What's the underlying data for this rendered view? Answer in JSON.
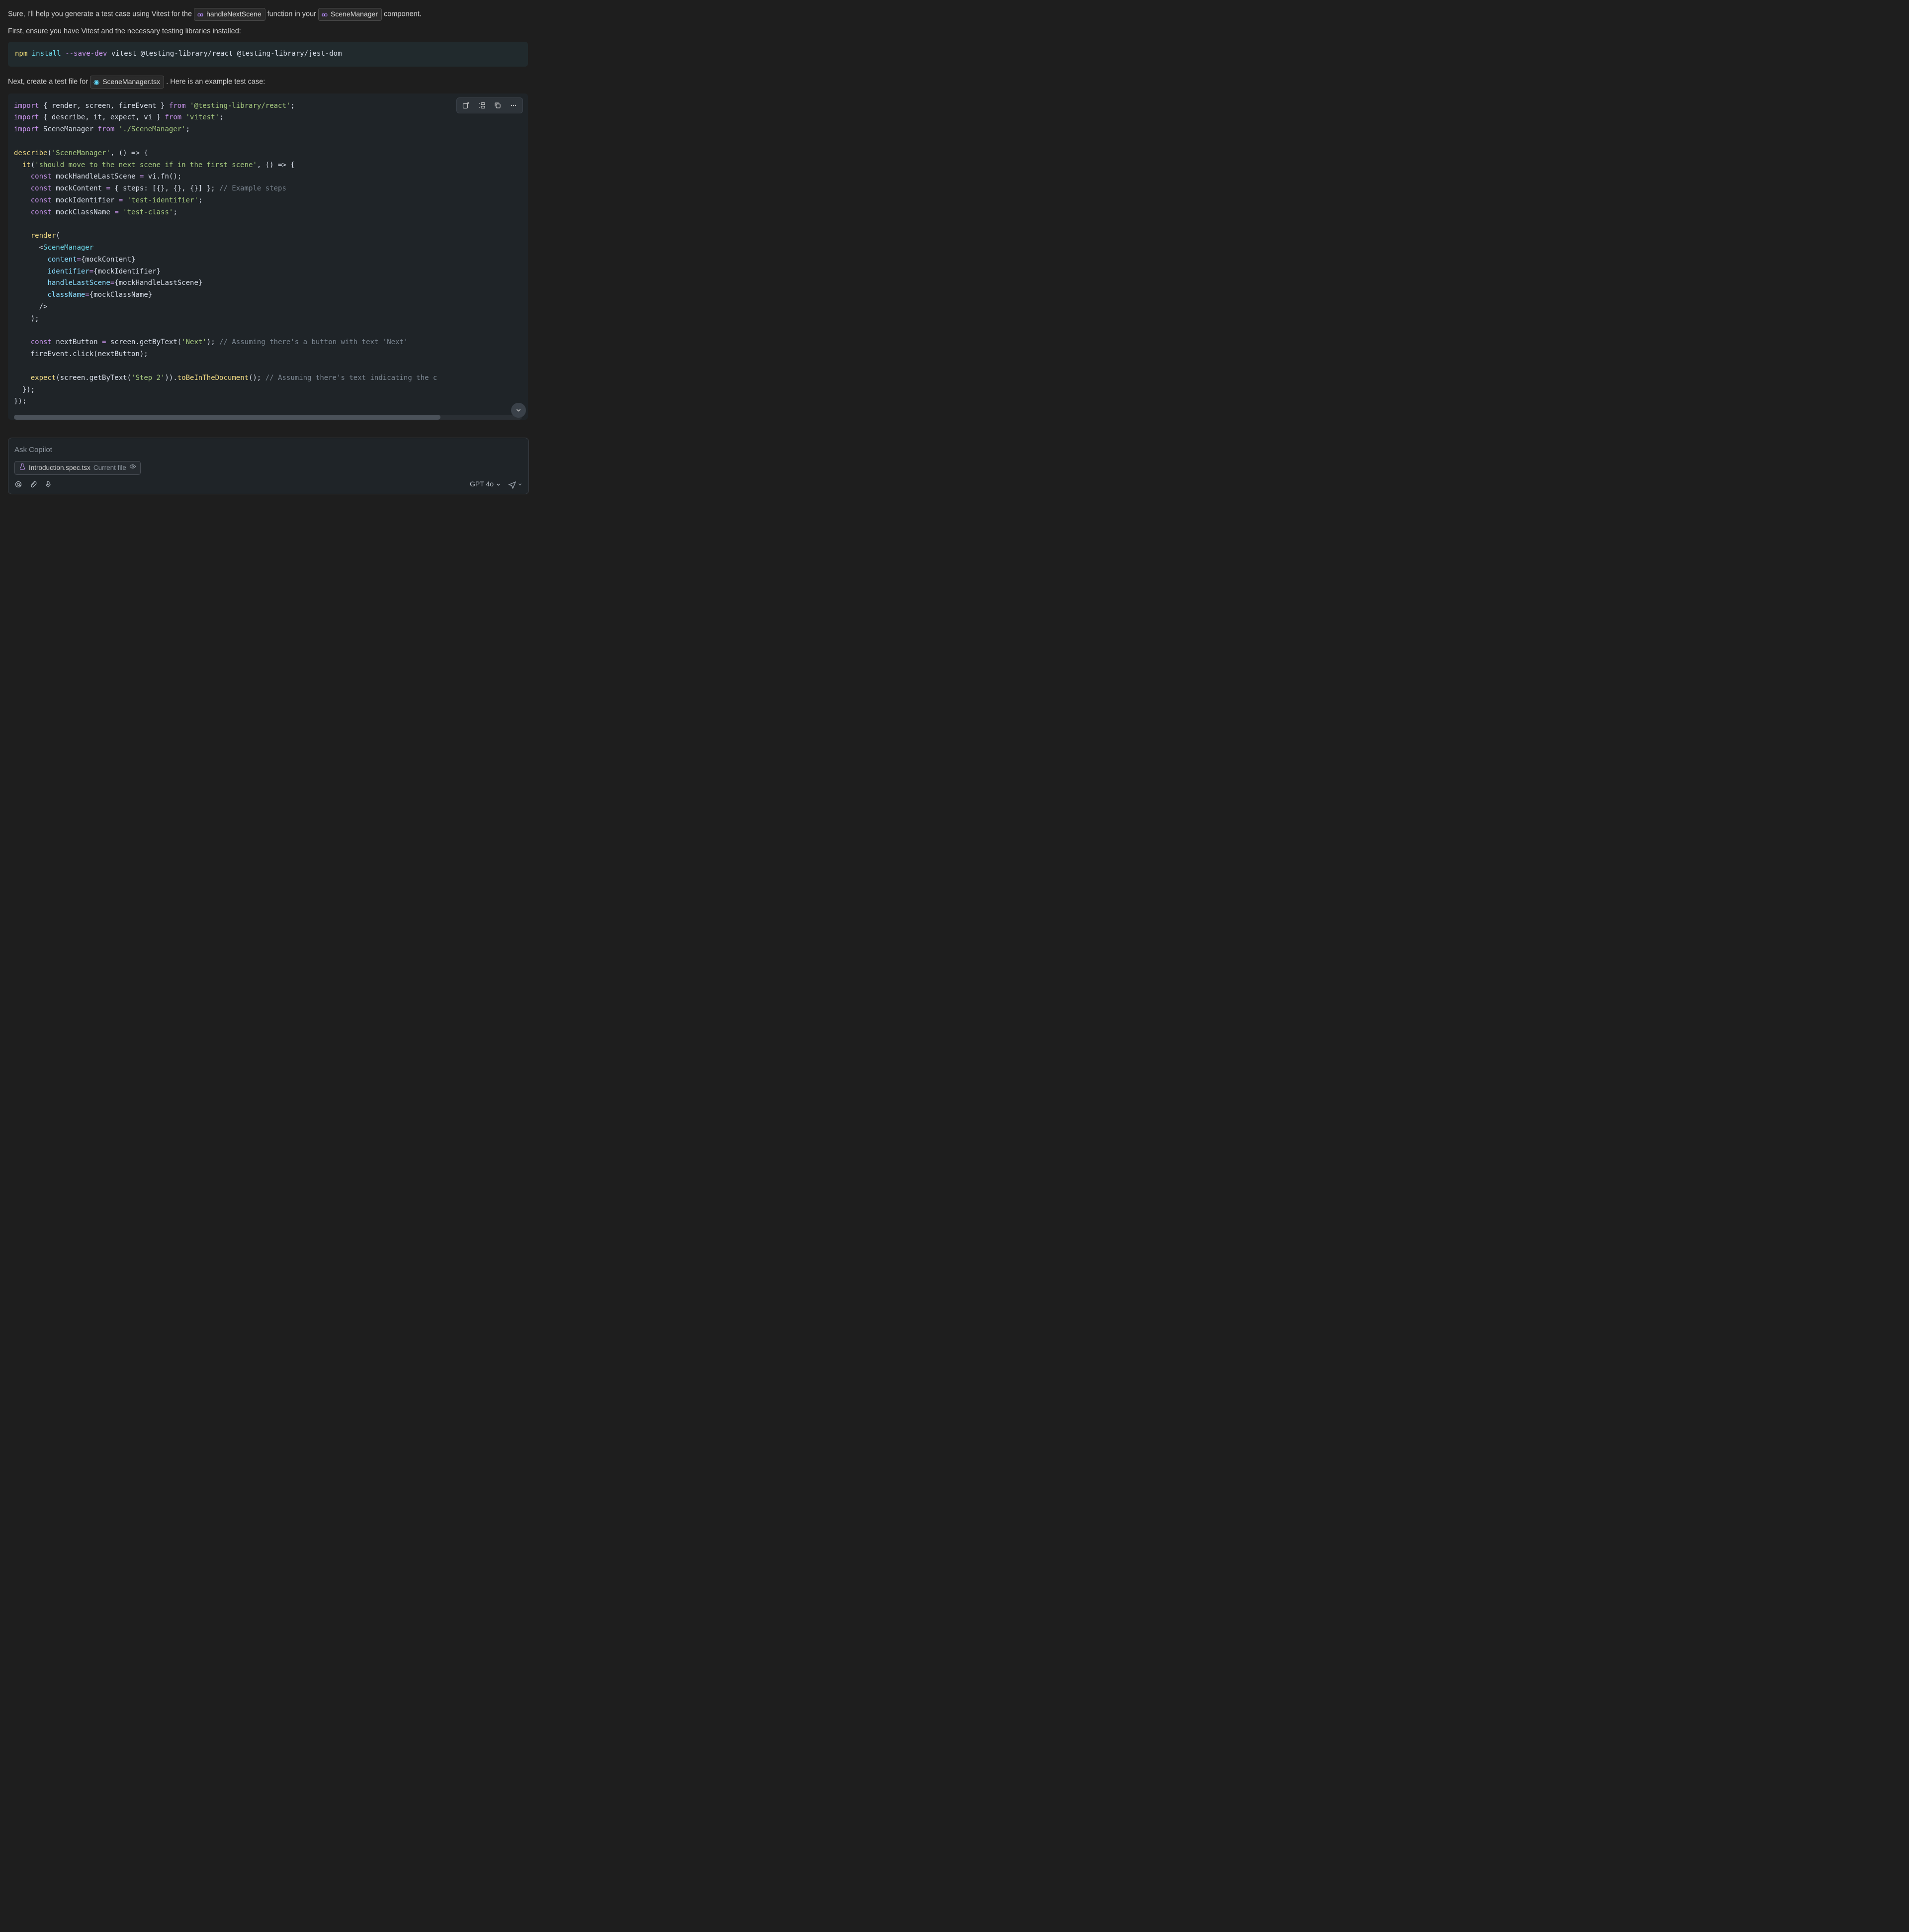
{
  "msg": {
    "p1a": "Sure, I'll help you generate a test case using Vitest for the ",
    "chip1": "handleNextScene",
    "p1b": " function in your ",
    "chip2": "SceneManager",
    "p1c": " component.",
    "p2": "First, ensure you have Vitest and the necessary testing libraries installed:",
    "p3a": "Next, create a test file for ",
    "chip3": "SceneManager.tsx",
    "p3b": ". Here is an example test case:"
  },
  "cmd": {
    "npm": "npm",
    "install": "install",
    "flag": "--save-dev",
    "pkgs": "vitest @testing-library/react @testing-library/jest-dom"
  },
  "code": {
    "l1": {
      "imp": "import",
      "br1": " { ",
      "names": "render, screen, fireEvent",
      "br2": " } ",
      "from": "from",
      "sp": " ",
      "mod": "'@testing-library/react'",
      "semi": ";"
    },
    "l2": {
      "imp": "import",
      "br1": " { ",
      "names": "describe, it, expect, vi",
      "br2": " } ",
      "from": "from",
      "sp": " ",
      "mod": "'vitest'",
      "semi": ";"
    },
    "l3": {
      "imp": "import",
      "name": " SceneManager ",
      "from": "from",
      "sp": " ",
      "mod": "'./SceneManager'",
      "semi": ";"
    },
    "l5": {
      "fn": "describe",
      "open": "(",
      "arg": "'SceneManager'",
      "comma": ", ",
      "arrow": "() => {",
      "close": ""
    },
    "l6": {
      "pad": "  ",
      "fn": "it",
      "open": "(",
      "arg": "'should move to the next scene if in the first scene'",
      "comma": ", ",
      "arrow": "() => {"
    },
    "l7": {
      "pad": "    ",
      "kw": "const",
      "name": " mockHandleLastScene ",
      "eq": "= ",
      "rhs": "vi.fn();"
    },
    "l8": {
      "pad": "    ",
      "kw": "const",
      "name": " mockContent ",
      "eq": "= ",
      "rhs": "{ steps: [{}, {}, {}] }; ",
      "cm": "// Example steps"
    },
    "l9": {
      "pad": "    ",
      "kw": "const",
      "name": " mockIdentifier ",
      "eq": "= ",
      "rhs": "'test-identifier'",
      "semi": ";"
    },
    "l10": {
      "pad": "    ",
      "kw": "const",
      "name": " mockClassName ",
      "eq": "= ",
      "rhs": "'test-class'",
      "semi": ";"
    },
    "l12": {
      "pad": "    ",
      "fn": "render",
      "open": "("
    },
    "l13": {
      "pad": "      ",
      "lt": "<",
      "tag": "SceneManager"
    },
    "l14": {
      "pad": "        ",
      "attr": "content",
      "eq": "=",
      "ob": "{",
      "val": "mockContent",
      "cb": "}"
    },
    "l15": {
      "pad": "        ",
      "attr": "identifier",
      "eq": "=",
      "ob": "{",
      "val": "mockIdentifier",
      "cb": "}"
    },
    "l16": {
      "pad": "        ",
      "attr": "handleLastScene",
      "eq": "=",
      "ob": "{",
      "val": "mockHandleLastScene",
      "cb": "}"
    },
    "l17": {
      "pad": "        ",
      "attr": "className",
      "eq": "=",
      "ob": "{",
      "val": "mockClassName",
      "cb": "}"
    },
    "l18": {
      "pad": "      ",
      "close": "/>"
    },
    "l19": {
      "pad": "    ",
      "close": ");"
    },
    "l21": {
      "pad": "    ",
      "kw": "const",
      "name": " nextButton ",
      "eq": "= ",
      "rhs": "screen.getByText(",
      "arg": "'Next'",
      "close": "); ",
      "cm": "// Assuming there's a button with text 'Next'"
    },
    "l22": {
      "pad": "    ",
      "call": "fireEvent.click(nextButton);"
    },
    "l24": {
      "pad": "    ",
      "a": "expect",
      "open": "(",
      "b": "screen.getByText(",
      "arg": "'Step 2'",
      "c": ")).",
      "d": "toBeInTheDocument",
      "e": "(); ",
      "cm": "// Assuming there's text indicating the c"
    },
    "l25": {
      "pad": "  ",
      "close": "});"
    },
    "l26": {
      "close": "});"
    }
  },
  "composer": {
    "placeholder": "Ask Copilot",
    "file": "Introduction.spec.tsx",
    "fileSub": "Current file",
    "model": "GPT 4o"
  }
}
